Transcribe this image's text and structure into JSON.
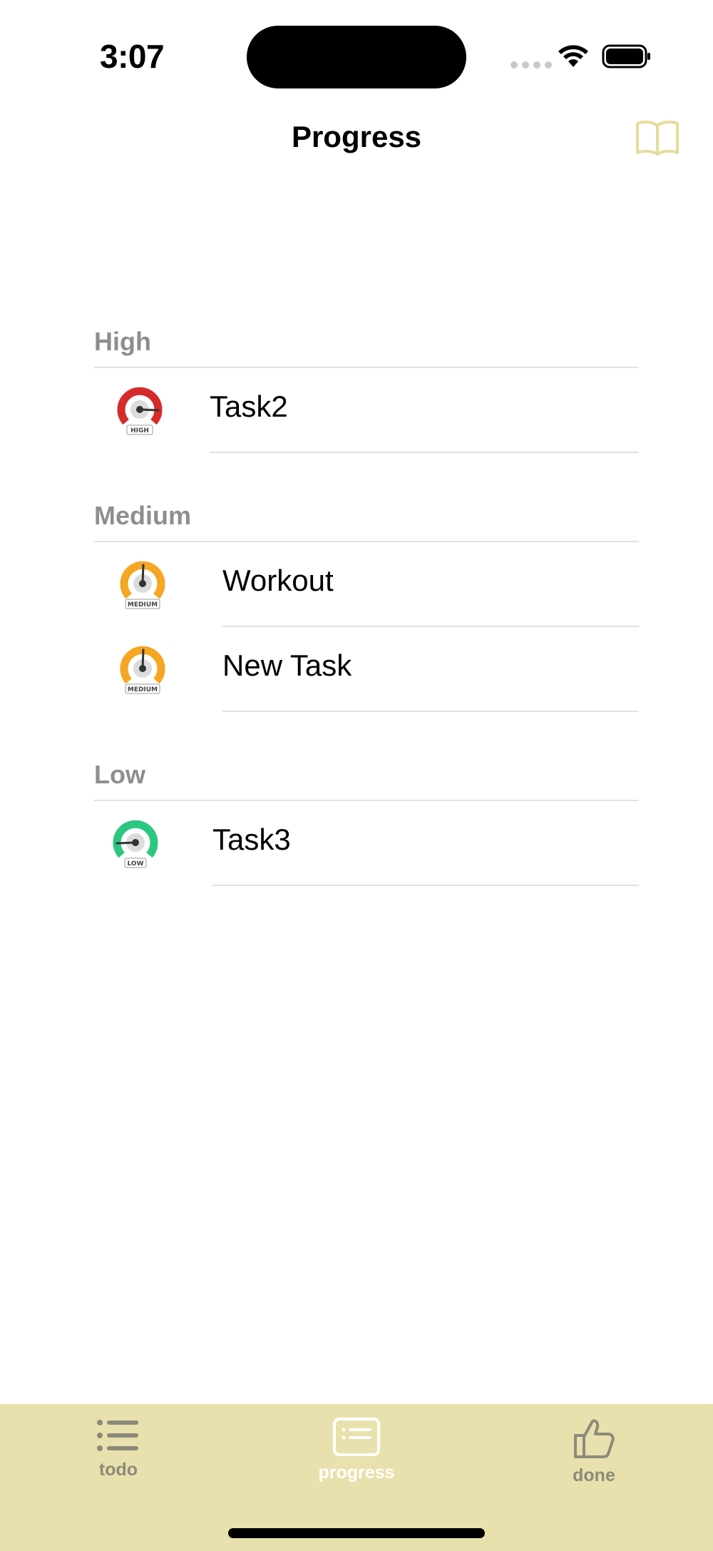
{
  "status_bar": {
    "time": "3:07"
  },
  "nav": {
    "title": "Progress",
    "right_icon": "book-icon"
  },
  "sections": [
    {
      "header": "High",
      "tasks": [
        {
          "label": "Task2",
          "priority_badge": "HIGH"
        }
      ]
    },
    {
      "header": "Medium",
      "tasks": [
        {
          "label": "Workout",
          "priority_badge": "MEDIUM"
        },
        {
          "label": "New Task",
          "priority_badge": "MEDIUM"
        }
      ]
    },
    {
      "header": "Low",
      "tasks": [
        {
          "label": "Task3",
          "priority_badge": "LOW"
        }
      ]
    }
  ],
  "tab_bar": {
    "tabs": [
      {
        "label": "todo",
        "icon": "list-icon",
        "selected": false
      },
      {
        "label": "progress",
        "icon": "card-list-icon",
        "selected": true
      },
      {
        "label": "done",
        "icon": "thumbs-up-icon",
        "selected": false
      }
    ]
  },
  "colors": {
    "tab_bar_bg": "#e8e1ad",
    "accent": "#e6dc9c",
    "high": "#d62b2b",
    "medium": "#f5a623",
    "low": "#2bc77f",
    "inactive_tab": "#8c8a7a",
    "active_tab": "#ffffff",
    "section_header": "#8e8e8e"
  }
}
